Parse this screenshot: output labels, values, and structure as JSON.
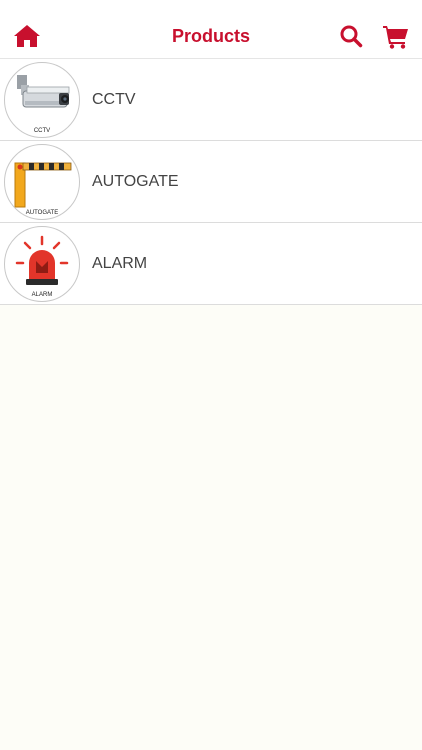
{
  "header": {
    "title": "Products",
    "accent_color": "#c8102e",
    "icons": {
      "home": "home-icon",
      "search": "search-icon",
      "cart": "cart-icon"
    }
  },
  "products": [
    {
      "label": "CCTV",
      "thumb_caption": "CCTV",
      "thumb_icon": "cctv-camera-icon"
    },
    {
      "label": "AUTOGATE",
      "thumb_caption": "AUTOGATE",
      "thumb_icon": "barrier-gate-icon"
    },
    {
      "label": "ALARM",
      "thumb_caption": "ALARM",
      "thumb_icon": "siren-alarm-icon"
    }
  ]
}
